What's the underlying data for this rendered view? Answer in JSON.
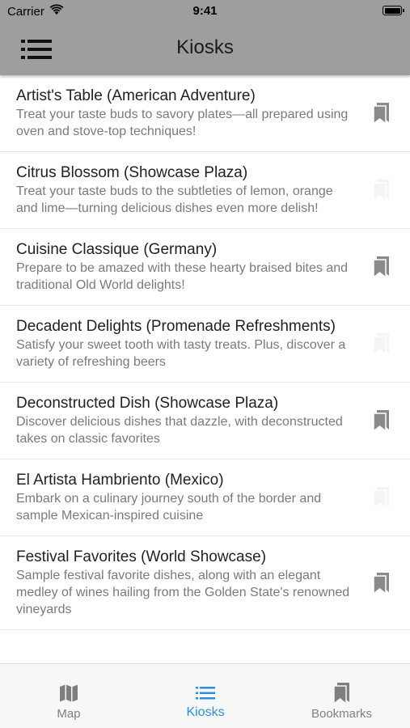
{
  "status_bar": {
    "carrier": "Carrier",
    "time": "9:41"
  },
  "nav": {
    "title": "Kiosks"
  },
  "kiosks": [
    {
      "title": "Artist's Table (American Adventure)",
      "description": "Treat your taste buds to savory plates—all prepared using oven and stove-top techniques!",
      "bookmarked": true
    },
    {
      "title": "Citrus Blossom (Showcase Plaza)",
      "description": "Treat your taste buds to the subtleties of lemon, orange and lime—turning delicious dishes even more delish!",
      "bookmarked": false
    },
    {
      "title": "Cuisine Classique (Germany)",
      "description": "Prepare to be amazed with these hearty braised bites and traditional Old World delights!",
      "bookmarked": true
    },
    {
      "title": "Decadent Delights (Promenade Refreshments)",
      "description": "Satisfy your sweet tooth with tasty treats. Plus, discover a variety of refreshing beers",
      "bookmarked": false
    },
    {
      "title": "Deconstructed Dish (Showcase Plaza)",
      "description": "Discover delicious dishes that dazzle, with deconstructed takes on classic favorites",
      "bookmarked": true
    },
    {
      "title": "El Artista Hambriento (Mexico)",
      "description": "Embark on a culinary journey south of the border and sample Mexican-inspired cuisine",
      "bookmarked": false
    },
    {
      "title": "Festival Favorites (World Showcase)",
      "description": "Sample festival favorite dishes, along with an elegant medley of wines hailing from the Golden State's renowned vineyards",
      "bookmarked": true
    }
  ],
  "tabs": {
    "map": {
      "label": "Map",
      "icon": "map-icon"
    },
    "kiosks": {
      "label": "Kiosks",
      "icon": "list-icon",
      "active": true
    },
    "bookmarks": {
      "label": "Bookmarks",
      "icon": "bookmarks-icon"
    }
  },
  "colors": {
    "nav_background": "#9e9e9e",
    "active_tab": "#2b8fe0",
    "inactive_tab": "#808080",
    "bookmark_on": "#8a8a8a",
    "bookmark_off": "#f4f4f4"
  }
}
